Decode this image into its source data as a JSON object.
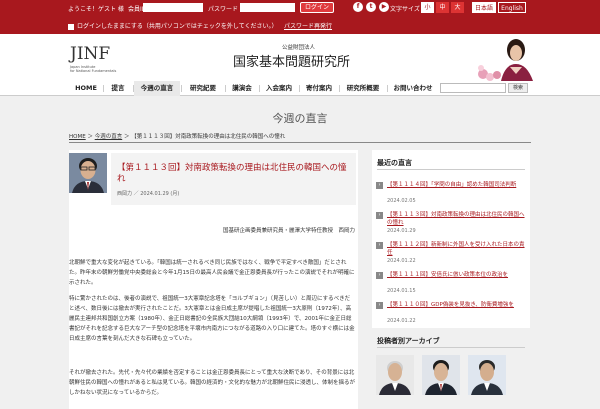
{
  "topbar": {
    "welcome": "ようこそ！ゲスト 様",
    "member_id_label": "会員ID",
    "password_label": "パスワード",
    "login_button": "ログイン",
    "social": [
      "f",
      "t",
      "▶"
    ],
    "font_size_label": "文字サイズ",
    "font_sizes": [
      "小",
      "中",
      "大"
    ],
    "languages": [
      "日本語",
      "English"
    ],
    "keep_login": "ログインしたままにする（共用パソコンではチェックを外してください。）",
    "password_reissue": "パスワード再発行"
  },
  "header": {
    "logo": "JINF",
    "logo_sub_1": "Japan Institute",
    "logo_sub_2": "for National Fundamentals",
    "org_small": "公益財団法人",
    "org_name": "国家基本問題研究所"
  },
  "nav": {
    "items": [
      "HOME",
      "提言",
      "今週の直言",
      "研究紀要",
      "講演会",
      "入会案内",
      "寄付案内",
      "研究所概要",
      "お問い合わせ"
    ],
    "search_button": "検索"
  },
  "page": {
    "title": "今週の直言",
    "breadcrumb_home": "HOME",
    "breadcrumb_section": "今週の直言",
    "breadcrumb_current": "【第１１１３回】対南政策転換の理由は北住民の韓国への憧れ"
  },
  "article": {
    "title": "【第１１１３回】対南政策転換の理由は北住民の韓国への憧れ",
    "author_short": "西岡力",
    "date": "2024.01.29 (月)",
    "author_line": "国基研企画委員兼研究員・麗澤大学特任教授　西岡力",
    "paragraphs": [
      "北朝鮮で重大な変化が起きている。「韓国は統一されるべき同じ民族ではなく、戦争で平定すべき敵国」だとされた。昨年末の朝鮮労働党中央委総会と今年1月15日の最高人民会議で金正恩委員長が行ったこの演説でそれが明確に示された。",
      "特に驚かされたのは、後者の演説で、祖国統一3大憲章記念塔を「ヨルブギョン」（見苦しい）と周辺にするべきだと述べ、数日後には撤去が実行されたことだ。3大憲章とは金日成主席が提唱した祖国統一3大原則（1972年）、高麗民主連邦共和国創立方案（1980年）、金正日総書記の全民族大団結10大綱領（1993年）で、2001年に金正日総書記がそれを記念する巨大なアーチ型の記念塔を平壌市内南方につながる道路の入り口に建てた。塔のすぐ横には金日成主席の言葉を刻んだ大きな石碑も立っていた。",
      "それが撤去された。先代・先々代の業績を否定することは金正恩委員長にとって重大な決断であり、その背景には北朝鮮住民の韓国への憧れがあると私は見ている。韓国の経済的・文化的な魅力が北朝鮮住民に浸透し、体制を揺るがしかねない状況になっているからだ。"
    ]
  },
  "sidebar": {
    "heading": "最近の直言",
    "items": [
      {
        "title": "【第１１１４回】「学問の自由」認めた韓国司法判断",
        "date": "2024.02.05"
      },
      {
        "title": "【第１１１３回】対南政策転換の理由は北住民の韓国への憧れ",
        "date": "2024.01.29"
      },
      {
        "title": "【第１１１２回】新新制に外国人を受け入れた日本の責任",
        "date": "2024.01.22"
      },
      {
        "title": "【第１１１１回】安倍氏に倣い政策本位の政治を",
        "date": "2024.01.15"
      },
      {
        "title": "【第１１１０回】GDP偽装を見抜き、防衛費増強を",
        "date": "2024.01.22"
      }
    ],
    "archive_heading": "投稿者別アーカイブ"
  },
  "colors": {
    "brand_red": "#a8181e",
    "page_gray": "#f0f0f0"
  }
}
